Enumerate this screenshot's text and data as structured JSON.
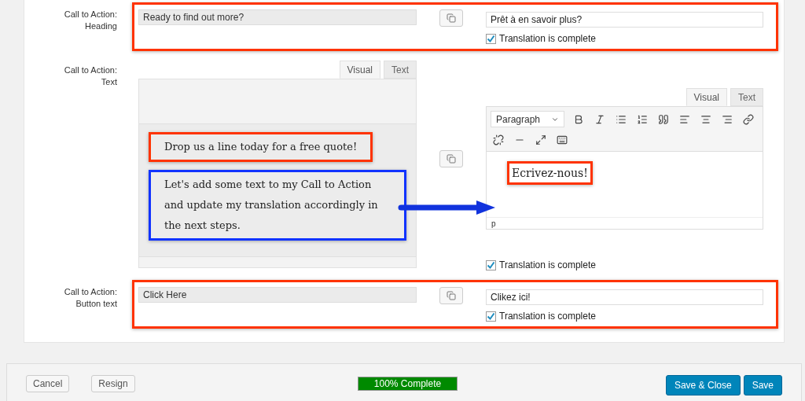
{
  "fields": [
    {
      "kind": "line",
      "label": [
        "Call to Action:",
        "Heading"
      ],
      "color": "#ff3300",
      "original": "Ready to find out more?",
      "translation": "Prêt à en savoir plus?",
      "complete_label": "Translation is complete",
      "complete": true
    },
    {
      "kind": "editor",
      "label": [
        "Call to Action:",
        "Text"
      ],
      "original": {
        "tabs": [
          {
            "label": "Visual",
            "selected": true
          },
          {
            "label": "Text",
            "selected": false
          }
        ],
        "paragraphs": [
          {
            "text": "Drop us a line today for a free quote!",
            "color": "#ff3300"
          },
          {
            "text": "Let's add some text to my Call to Action and update my translation accordingly in the next steps.",
            "color": "#1133ff"
          }
        ]
      },
      "translation": {
        "tabs": [
          {
            "label": "Visual",
            "selected": true
          },
          {
            "label": "Text",
            "selected": false
          }
        ],
        "format": "Paragraph",
        "paragraphs": [
          {
            "text": "Ecrivez-nous!",
            "color": "#ff3300"
          }
        ],
        "path": "p"
      },
      "complete_label": "Translation is complete",
      "complete": true
    },
    {
      "kind": "line",
      "label": [
        "Call to Action:",
        "Button text"
      ],
      "color": "#ff3300",
      "original": "Click Here",
      "translation": "Clikez ici!",
      "complete_label": "Translation is complete",
      "complete": true
    }
  ],
  "footer": {
    "left_buttons": [
      "Cancel",
      "Resign"
    ],
    "progress": {
      "label": "100% Complete",
      "level": 1
    },
    "right_buttons": [
      "Save & Close",
      "Save"
    ]
  }
}
